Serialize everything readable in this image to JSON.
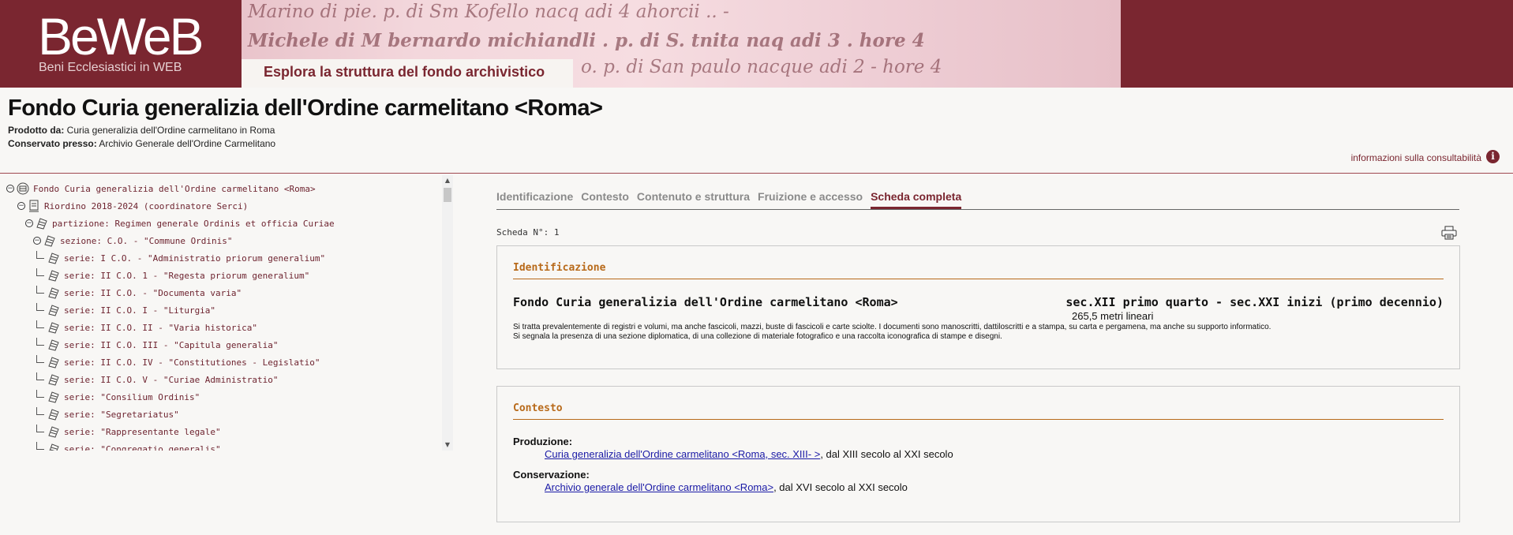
{
  "header": {
    "logo": "BeWeB",
    "logo_subtitle": "Beni Ecclesiastici in WEB",
    "banner_title": "Esplora la struttura del fondo archivistico",
    "banner_script": [
      "Marino di pie. p. di Sm Kofello nacq adi 4 ahorcii .. -",
      "Michele di M bernardo michiandli . p. di S. tnita naq adi 3 . hore 4",
      "o. p. di San paulo nacque adi 2 - hore 4"
    ],
    "accent_color": "#7a2630"
  },
  "fondo": {
    "title": "Fondo Curia generalizia dell'Ordine carmelitano <Roma>",
    "prodotto_label": "Prodotto da:",
    "prodotto_value": "Curia generalizia dell'Ordine carmelitano in Roma",
    "conservato_label": "Conservato presso:",
    "conservato_value": "Archivio Generale dell'Ordine Carmelitano",
    "consult_link": "informazioni sulla consultabilità",
    "info_icon": "i"
  },
  "tree": {
    "items": [
      {
        "label": "Fondo Curia generalizia dell'Ordine carmelitano <Roma>",
        "icon": "fondo-icon"
      },
      {
        "label": "Riordino 2018-2024 (coordinatore Serci)",
        "icon": "riordino-icon"
      },
      {
        "label": "partizione: Regimen generale Ordinis et officia Curiae",
        "icon": "folder-icon"
      },
      {
        "label": "sezione: C.O. - \"Commune Ordinis\"",
        "icon": "folder-icon"
      },
      {
        "label": "serie: I C.O. - \"Administratio priorum generalium\"",
        "icon": "folder-icon"
      },
      {
        "label": "serie: II C.O. 1 - \"Regesta priorum generalium\"",
        "icon": "folder-icon"
      },
      {
        "label": "serie: II C.O. - \"Documenta varia\"",
        "icon": "folder-icon"
      },
      {
        "label": "serie: II C.O. I - \"Liturgia\"",
        "icon": "folder-icon"
      },
      {
        "label": "serie: II C.O. II - \"Varia historica\"",
        "icon": "folder-icon"
      },
      {
        "label": "serie: II C.O. III - \"Capitula generalia\"",
        "icon": "folder-icon"
      },
      {
        "label": "serie: II C.O. IV - \"Constitutiones - Legislatio\"",
        "icon": "folder-icon"
      },
      {
        "label": "serie: II C.O. V - \"Curiae Administratio\"",
        "icon": "folder-icon"
      },
      {
        "label": "serie: \"Consilium Ordinis\"",
        "icon": "folder-icon"
      },
      {
        "label": "serie: \"Segretariatus\"",
        "icon": "folder-icon"
      },
      {
        "label": "serie: \"Rappresentante legale\"",
        "icon": "folder-icon"
      },
      {
        "label": "serie: \"Congregatio generalis\"",
        "icon": "folder-icon"
      }
    ]
  },
  "tabs": [
    {
      "label": "Identificazione",
      "active": false
    },
    {
      "label": "Contesto",
      "active": false
    },
    {
      "label": "Contenuto e struttura",
      "active": false
    },
    {
      "label": "Fruizione e accesso",
      "active": false
    },
    {
      "label": "Scheda completa",
      "active": true
    }
  ],
  "scheda": {
    "number_label": "Scheda N°: 1"
  },
  "identificazione": {
    "heading": "Identificazione",
    "name": "Fondo Curia generalizia dell'Ordine carmelitano <Roma>",
    "date": "sec.XII primo quarto - sec.XXI inizi (primo decennio)",
    "extent": "265,5 metri lineari",
    "desc_1": "Si tratta prevalentemente di registri e volumi, ma anche fascicoli, mazzi, buste di fascicoli e carte sciolte. I documenti sono manoscritti, dattiloscritti e a stampa, su carta e pergamena, ma anche su supporto informatico.",
    "desc_2": "Si segnala la presenza di una sezione diplomatica, di una collezione di materiale fotografico e una raccolta iconografica di stampe e disegni."
  },
  "contesto": {
    "heading": "Contesto",
    "produzione_label": "Produzione:",
    "produzione_link": "Curia generalizia dell'Ordine carmelitano <Roma, sec. XIII- >",
    "produzione_rest": ", dal XIII secolo al XXI secolo",
    "conservazione_label": "Conservazione:",
    "conservazione_link": "Archivio generale dell'Ordine carmelitano <Roma>",
    "conservazione_rest": ", dal XVI secolo al XXI secolo"
  }
}
